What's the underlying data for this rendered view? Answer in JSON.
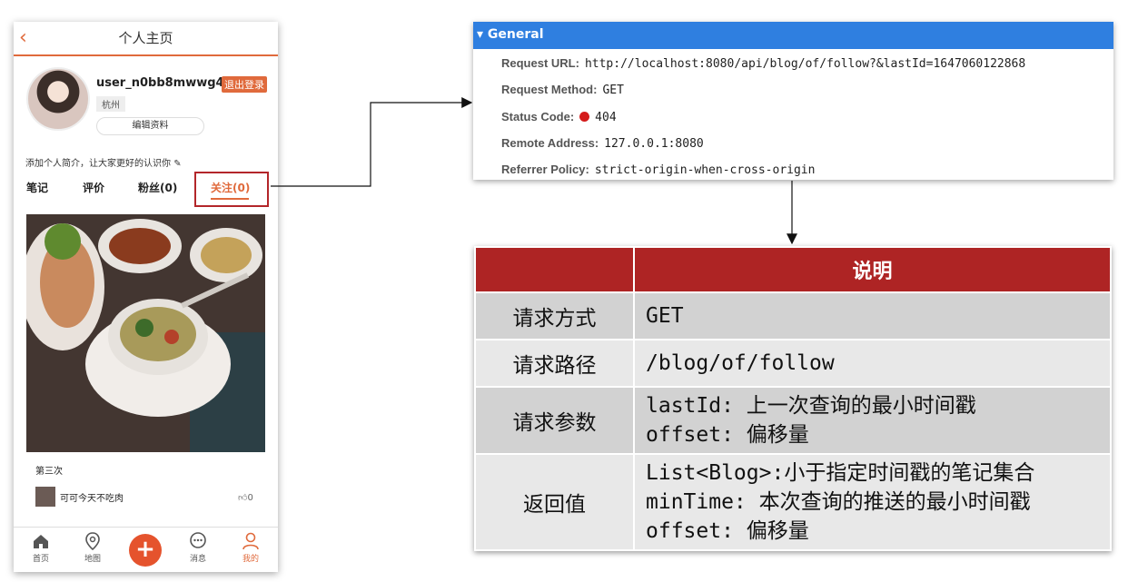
{
  "phone": {
    "back_icon": "chevron-left-icon",
    "title": "个人主页",
    "username": "user_n0bb8mwwg4",
    "logout_label": "退出登录",
    "city": "杭州",
    "edit_profile_label": "编辑资料",
    "bio": "添加个人简介，让大家更好的认识你",
    "tabs": [
      {
        "label": "笔记"
      },
      {
        "label": "评价"
      },
      {
        "label": "粉丝(0)"
      },
      {
        "label": "关注(0)"
      }
    ],
    "active_tab": "关注(0)",
    "card": {
      "title": "第三次",
      "user": "可可今天不吃肉",
      "likes": "0"
    },
    "nav": [
      {
        "label": "首页",
        "icon": "home-icon"
      },
      {
        "label": "地图",
        "icon": "map-pin-icon"
      },
      {
        "label": "+",
        "icon": "plus-icon"
      },
      {
        "label": "消息",
        "icon": "chat-icon"
      },
      {
        "label": "我的",
        "icon": "user-icon"
      }
    ],
    "accent": "#e06a3c"
  },
  "general": {
    "header": "General",
    "rows": [
      {
        "key": "Request URL:",
        "value": "http://localhost:8080/api/blog/of/follow?&lastId=1647060122868"
      },
      {
        "key": "Request Method:",
        "value": "GET"
      },
      {
        "key": "Status Code:",
        "value": "404"
      },
      {
        "key": "Remote Address:",
        "value": "127.0.0.1:8080"
      },
      {
        "key": "Referrer Policy:",
        "value": "strict-origin-when-cross-origin"
      }
    ],
    "header_color": "#2f7fe0"
  },
  "table": {
    "header": "说明",
    "rows": [
      {
        "key": "请求方式",
        "lines": [
          "GET"
        ]
      },
      {
        "key": "请求路径",
        "lines": [
          "/blog/of/follow"
        ]
      },
      {
        "key": "请求参数",
        "lines": [
          "lastId: 上一次查询的最小时间戳",
          "offset: 偏移量"
        ]
      },
      {
        "key": "返回值",
        "lines": [
          "List<Blog>:小于指定时间戳的笔记集合",
          "minTime: 本次查询的推送的最小时间戳",
          "offset: 偏移量"
        ]
      }
    ],
    "header_color": "#ae2424"
  }
}
